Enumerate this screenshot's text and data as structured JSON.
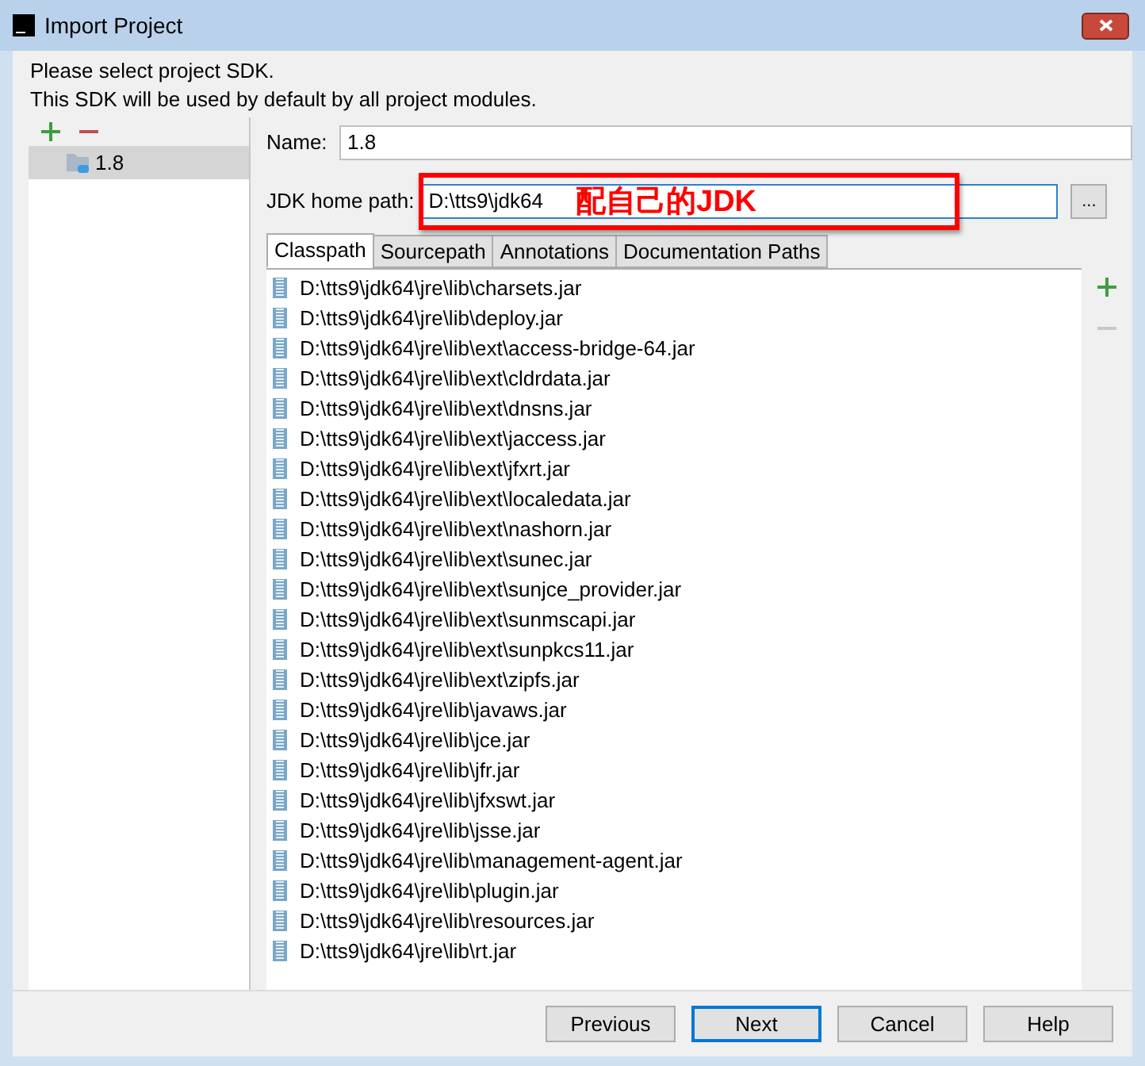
{
  "window": {
    "title": "Import Project"
  },
  "intro": [
    "Please select project SDK.",
    "This SDK will be used by default by all project modules."
  ],
  "sdk_list": [
    {
      "label": "1.8",
      "selected": true
    }
  ],
  "name": {
    "label": "Name:",
    "value": "1.8"
  },
  "jdk_home": {
    "label": "JDK home path:",
    "value": "D:\\tts9\\jdk64",
    "browse": "..."
  },
  "annotation": "配自己的JDK",
  "tabs": [
    {
      "label": "Classpath",
      "selected": true
    },
    {
      "label": "Sourcepath",
      "selected": false
    },
    {
      "label": "Annotations",
      "selected": false
    },
    {
      "label": "Documentation Paths",
      "selected": false
    }
  ],
  "classpath": [
    "D:\\tts9\\jdk64\\jre\\lib\\charsets.jar",
    "D:\\tts9\\jdk64\\jre\\lib\\deploy.jar",
    "D:\\tts9\\jdk64\\jre\\lib\\ext\\access-bridge-64.jar",
    "D:\\tts9\\jdk64\\jre\\lib\\ext\\cldrdata.jar",
    "D:\\tts9\\jdk64\\jre\\lib\\ext\\dnsns.jar",
    "D:\\tts9\\jdk64\\jre\\lib\\ext\\jaccess.jar",
    "D:\\tts9\\jdk64\\jre\\lib\\ext\\jfxrt.jar",
    "D:\\tts9\\jdk64\\jre\\lib\\ext\\localedata.jar",
    "D:\\tts9\\jdk64\\jre\\lib\\ext\\nashorn.jar",
    "D:\\tts9\\jdk64\\jre\\lib\\ext\\sunec.jar",
    "D:\\tts9\\jdk64\\jre\\lib\\ext\\sunjce_provider.jar",
    "D:\\tts9\\jdk64\\jre\\lib\\ext\\sunmscapi.jar",
    "D:\\tts9\\jdk64\\jre\\lib\\ext\\sunpkcs11.jar",
    "D:\\tts9\\jdk64\\jre\\lib\\ext\\zipfs.jar",
    "D:\\tts9\\jdk64\\jre\\lib\\javaws.jar",
    "D:\\tts9\\jdk64\\jre\\lib\\jce.jar",
    "D:\\tts9\\jdk64\\jre\\lib\\jfr.jar",
    "D:\\tts9\\jdk64\\jre\\lib\\jfxswt.jar",
    "D:\\tts9\\jdk64\\jre\\lib\\jsse.jar",
    "D:\\tts9\\jdk64\\jre\\lib\\management-agent.jar",
    "D:\\tts9\\jdk64\\jre\\lib\\plugin.jar",
    "D:\\tts9\\jdk64\\jre\\lib\\resources.jar",
    "D:\\tts9\\jdk64\\jre\\lib\\rt.jar"
  ],
  "buttons": [
    {
      "label": "Previous",
      "kind": "default"
    },
    {
      "label": "Next",
      "kind": "primary"
    },
    {
      "label": "Cancel",
      "kind": "default"
    },
    {
      "label": "Help",
      "kind": "default"
    }
  ]
}
